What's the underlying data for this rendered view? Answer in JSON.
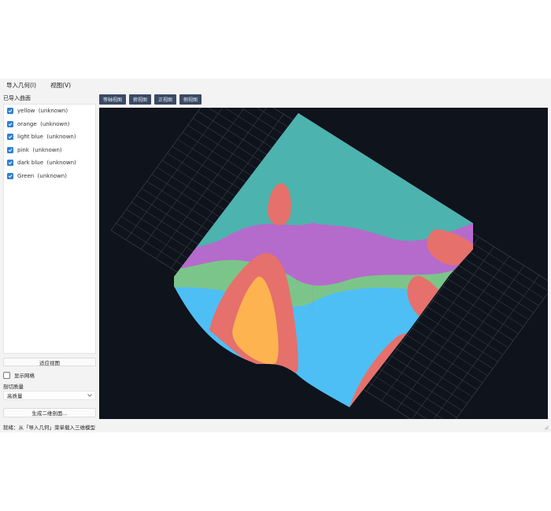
{
  "menu": {
    "import_geometry": "导入几何(I)",
    "view": "视图(V)"
  },
  "sidebar": {
    "section_title": "已导入曲面",
    "surfaces": [
      {
        "name": "yellow",
        "status": "(unknown)"
      },
      {
        "name": "orange",
        "status": "(unknown)"
      },
      {
        "name": "light blue",
        "status": "(unknown)"
      },
      {
        "name": "pink",
        "status": "(unknown)"
      },
      {
        "name": "dark blue",
        "status": "(unknown)"
      },
      {
        "name": "Green",
        "status": "(unknown)"
      }
    ],
    "fit_view_label": "适应视图",
    "show_mesh_label": "显示网格",
    "section_quality_title": "剖切质量",
    "quality_value": "高质量",
    "generate_label": "生成二维剖面..."
  },
  "toolbar": {
    "buttons": [
      "等轴视图",
      "俯视图",
      "正视图",
      "侧视图"
    ]
  },
  "statusbar": {
    "text": "就绪：从「导入几何」菜单载入三维模型"
  },
  "colors": {
    "checkbox": "#2f7fd2",
    "viewport_bg": "#0f131b",
    "grid": "#3a4150",
    "teal": "#4db3ae",
    "purple": "#b56bcb",
    "green": "#7cc58a",
    "light_blue": "#4dbff5",
    "salmon": "#e6706b",
    "yellow": "#fdb350"
  }
}
